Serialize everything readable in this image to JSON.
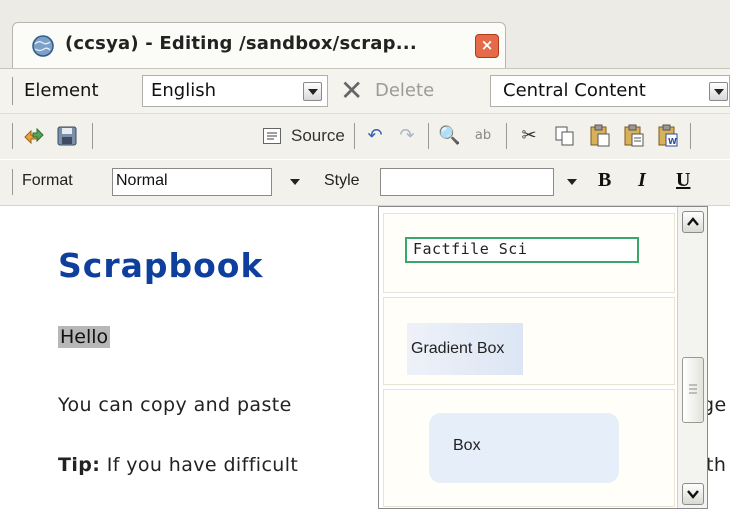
{
  "tab": {
    "title": "(ccsya) - Editing /sandbox/scrap..."
  },
  "element_bar": {
    "element_label": "Element",
    "language": "English",
    "delete_label": "Delete",
    "region": "Central Content"
  },
  "toolbar": {
    "source_label": "Source"
  },
  "format_bar": {
    "format_label": "Format",
    "format_value": "Normal",
    "style_label": "Style",
    "style_value": "",
    "bold": "B",
    "italic": "I",
    "underline": "U"
  },
  "style_dropdown": {
    "options": [
      {
        "label": "Factfile Sci"
      },
      {
        "label": "Gradient Box"
      },
      {
        "label": "Box"
      }
    ]
  },
  "content": {
    "heading": "Scrapbook",
    "hello": "Hello",
    "para1_visible": "You can copy and paste",
    "para1_tail": "age",
    "para2_bold": "Tip:",
    "para2_visible": " If you have difficult",
    "para2_tail": "th"
  },
  "colors": {
    "heading": "#0f3f9c",
    "factfile_border": "#3aa66b",
    "box_fill": "#e6eefa"
  }
}
